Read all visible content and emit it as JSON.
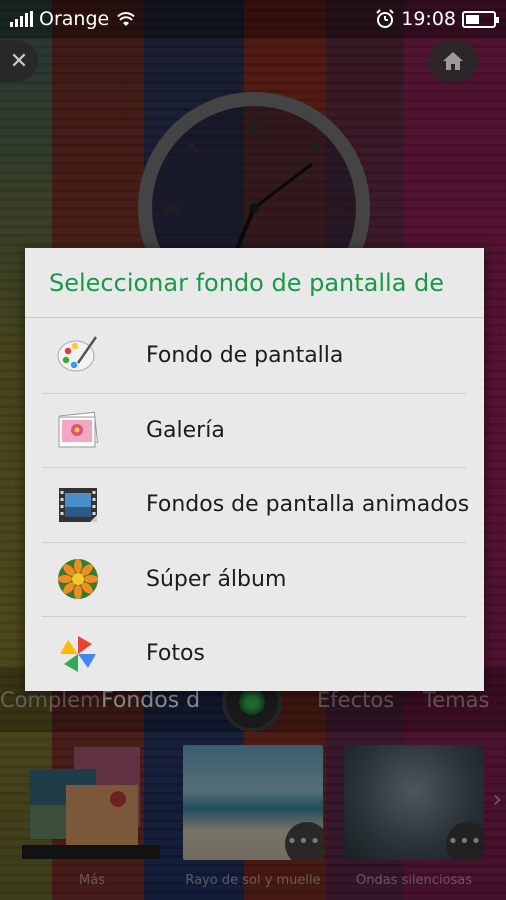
{
  "status_bar": {
    "carrier": "Orange",
    "time": "19:08",
    "battery_level": 0.5
  },
  "tabs": {
    "items": [
      {
        "label": "Complem"
      },
      {
        "label": "Fondos d",
        "active": true
      },
      {
        "label": "Efectos"
      },
      {
        "label": "Temas"
      }
    ]
  },
  "thumbnails": [
    {
      "label": "Más"
    },
    {
      "label": "Rayo de sol y muelle"
    },
    {
      "label": "Ondas silenciosas"
    }
  ],
  "dialog": {
    "title": "Seleccionar fondo de pantalla de",
    "options": [
      {
        "label": "Fondo de pantalla",
        "icon": "palette-icon"
      },
      {
        "label": "Galería",
        "icon": "gallery-icon"
      },
      {
        "label": "Fondos de pantalla animados",
        "icon": "film-icon"
      },
      {
        "label": "Súper álbum",
        "icon": "flower-icon"
      },
      {
        "label": "Fotos",
        "icon": "pinwheel-icon"
      }
    ]
  },
  "colors": {
    "dialog_title": "#179a48",
    "dialog_bg": "#e9e9e9"
  }
}
